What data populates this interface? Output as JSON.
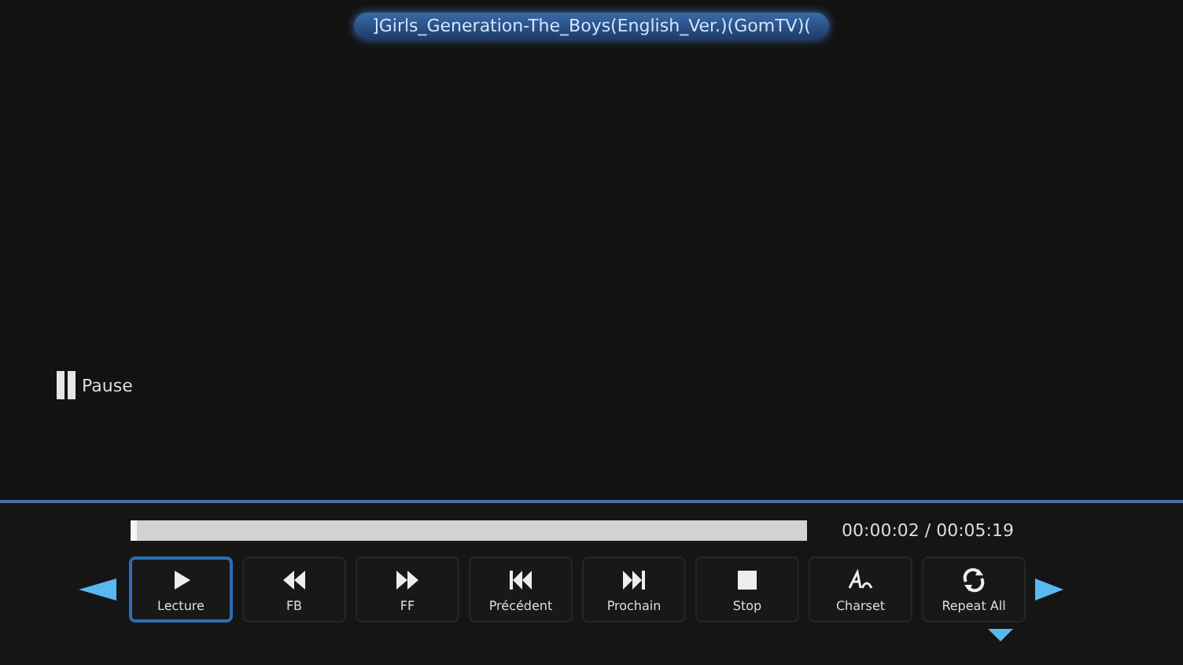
{
  "title": "]Girls_Generation-The_Boys(English_Ver.)(GomTV)(",
  "status": {
    "kind": "pause",
    "label": "Pause"
  },
  "progress": {
    "level": 0.01,
    "time": "00:00:02 / 00:05:19"
  },
  "buttons": [
    {
      "kind": "play",
      "label": "Lecture",
      "selected": true
    },
    {
      "kind": "rewind",
      "label": "FB",
      "selected": false
    },
    {
      "kind": "forward",
      "label": "FF",
      "selected": false
    },
    {
      "kind": "previous",
      "label": "Précédent",
      "selected": false
    },
    {
      "kind": "next",
      "label": "Prochain",
      "selected": false
    },
    {
      "kind": "stop",
      "label": "Stop",
      "selected": false
    },
    {
      "kind": "charset",
      "label": "Charset",
      "selected": false
    },
    {
      "kind": "repeat",
      "label": "Repeat All",
      "selected": false
    }
  ]
}
